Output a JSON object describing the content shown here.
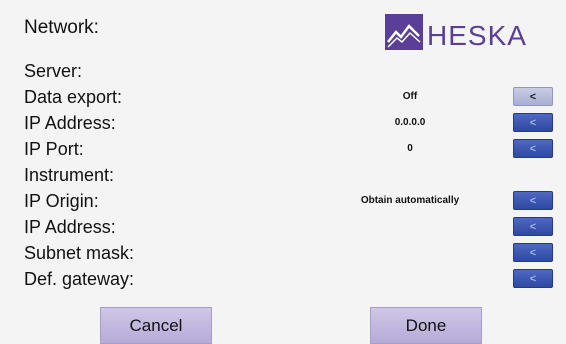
{
  "header": {
    "title": "Network:"
  },
  "logo": {
    "text": "HESKA"
  },
  "rows": [
    {
      "label": "Server:",
      "value": ""
    },
    {
      "label": "Data export:",
      "value": "Off"
    },
    {
      "label": "IP Address:",
      "value": "0.0.0.0"
    },
    {
      "label": "IP Port:",
      "value": "0"
    },
    {
      "label": "Instrument:",
      "value": ""
    },
    {
      "label": "IP Origin:",
      "value": "Obtain automatically"
    },
    {
      "label": "IP Address:",
      "value": ""
    },
    {
      "label": "Subnet mask:",
      "value": ""
    },
    {
      "label": "Def. gateway:",
      "value": ""
    }
  ],
  "arrow_symbol": "<",
  "buttons": {
    "cancel": "Cancel",
    "done": "Done"
  },
  "colors": {
    "accent": "#3a54b0",
    "brand": "#5b3f97",
    "button": "#c3b9e0"
  }
}
